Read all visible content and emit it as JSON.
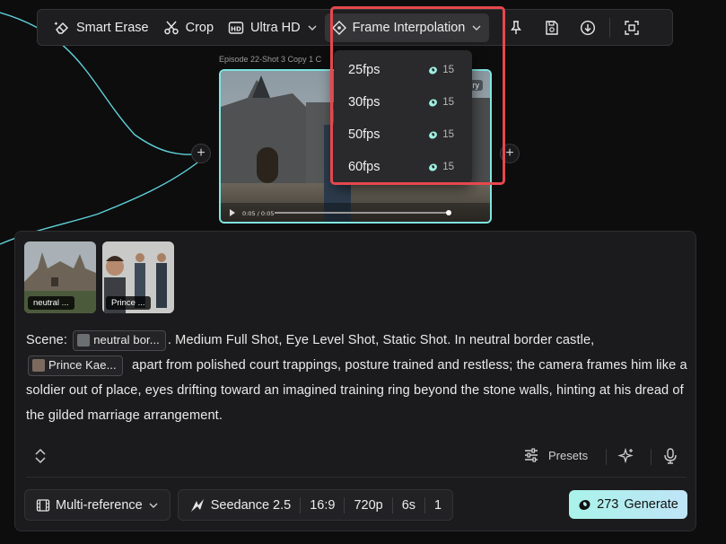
{
  "toolbar": {
    "smart_erase": "Smart Erase",
    "crop": "Crop",
    "ultra_hd": "Ultra HD",
    "frame_interpolation": "Frame Interpolation"
  },
  "frame_menu": [
    {
      "label": "25fps",
      "cost": "15"
    },
    {
      "label": "30fps",
      "cost": "15"
    },
    {
      "label": "50fps",
      "cost": "15"
    },
    {
      "label": "60fps",
      "cost": "15"
    }
  ],
  "video_node": {
    "title": "Episode 22-Shot 3 Copy 1 C",
    "corner_label": "ry",
    "time": "0:05 / 0:05"
  },
  "references": [
    {
      "label": "neutral ..."
    },
    {
      "label": "Prince ..."
    }
  ],
  "prompt": {
    "scene_label": "Scene:",
    "chip1": "neutral bor...",
    "text1": ". Medium Full Shot, Eye Level Shot, Static Shot. In neutral border castle,",
    "chip2": "Prince Kae...",
    "text2": "apart from polished court trappings, posture trained and restless; the camera frames him like a soldier out of place, eyes drifting toward an imagined training ring beyond the stone walls, hinting at his dread of the gilded marriage arrangement."
  },
  "controls": {
    "presets": "Presets",
    "mode": "Multi-reference",
    "model": "Seedance 2.5",
    "ratio": "16:9",
    "resolution": "720p",
    "duration": "6s",
    "count": "1",
    "generate_cost": "273",
    "generate_label": "Generate"
  },
  "colors": {
    "accent_teal": "#7fe6e0",
    "highlight_red": "#e5484d",
    "generate_gradient_start": "#a9f3ea",
    "generate_gradient_end": "#bfe4f7"
  }
}
